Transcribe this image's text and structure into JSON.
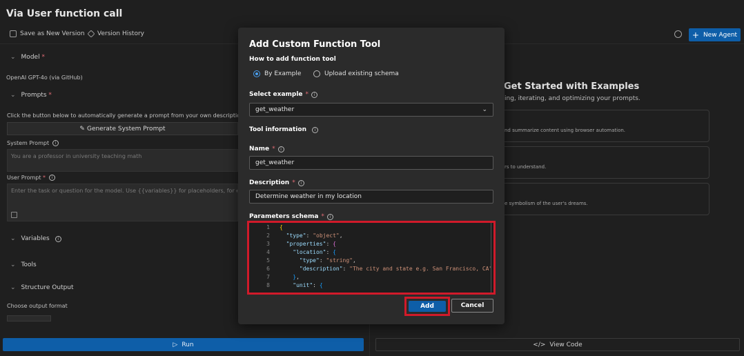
{
  "page": {
    "title": "Via User function call"
  },
  "toolbar": {
    "save_label": "Save as New Version",
    "history_label": "Version History",
    "new_agent_label": "New Agent"
  },
  "left": {
    "model_label": "Model",
    "model_value": "OpenAI GPT-4o (via GitHub)",
    "prompts_label": "Prompts",
    "prompts_hint": "Click the button below to automatically generate a prompt from your own descriptio",
    "generate_label": "Generate System Prompt",
    "system_prompt_label": "System Prompt",
    "system_prompt_placeholder": "You are a professor in university teaching math",
    "user_prompt_label": "User Prompt",
    "user_prompt_placeholder": "Enter the task or question for the model. Use {{variables}} for placeholders, for example: \"E",
    "variables_label": "Variables",
    "tools_label": "Tools",
    "structure_label": "Structure Output",
    "output_format_label": "Choose output format",
    "run_label": "Run"
  },
  "right": {
    "title": "Get Started with Examples",
    "subtitle": "ing, iterating, and optimizing your prompts.",
    "cards": [
      {
        "text": "nd summarize content using browser automation."
      },
      {
        "text": "rs to understand."
      },
      {
        "text": "e symbolism of the user's dreams."
      }
    ],
    "view_code_label": "View Code"
  },
  "modal": {
    "title": "Add Custom Function Tool",
    "how_label": "How to add function tool",
    "option_example": "By Example",
    "option_upload": "Upload existing schema",
    "select_example_label": "Select example",
    "select_example_value": "get_weather",
    "tool_info_label": "Tool information",
    "name_label": "Name",
    "name_value": "get_weather",
    "description_label": "Description",
    "description_value": "Determine weather in my location",
    "params_label": "Parameters schema",
    "code_lines": [
      {
        "n": "1",
        "text": "{"
      },
      {
        "n": "2",
        "text": "  \"type\": \"object\","
      },
      {
        "n": "3",
        "text": "  \"properties\": {"
      },
      {
        "n": "4",
        "text": "    \"location\": {"
      },
      {
        "n": "5",
        "text": "      \"type\": \"string\","
      },
      {
        "n": "6",
        "text": "      \"description\": \"The city and state e.g. San Francisco, CA\""
      },
      {
        "n": "7",
        "text": "    },"
      },
      {
        "n": "8",
        "text": "    \"unit\": {"
      }
    ],
    "add_label": "Add",
    "cancel_label": "Cancel"
  },
  "colors": {
    "accent": "#0e5ea8",
    "highlight": "#d11a2a"
  }
}
